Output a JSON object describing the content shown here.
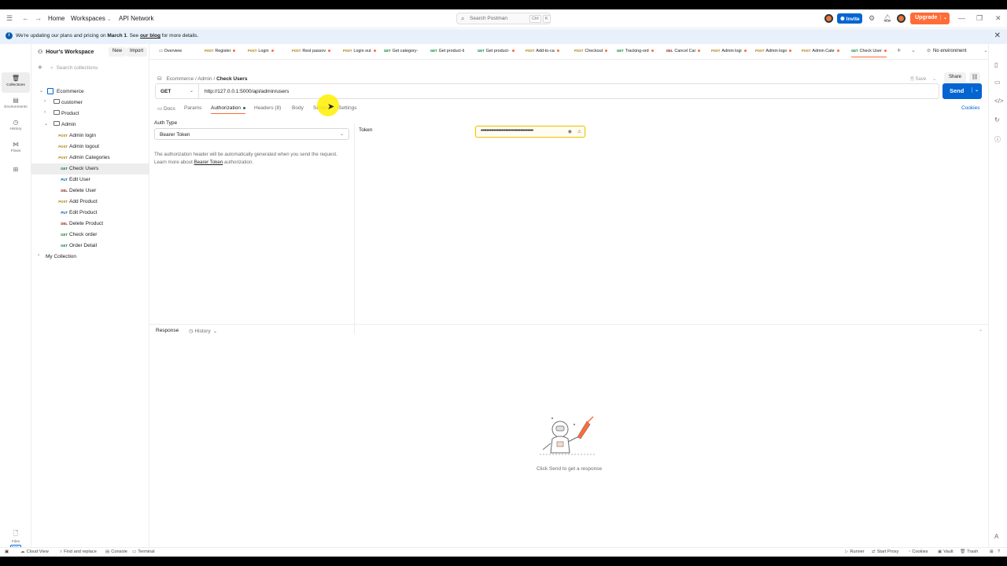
{
  "header": {
    "nav": {
      "home": "Home",
      "workspaces": "Workspaces",
      "api_network": "API Network"
    },
    "search": {
      "placeholder": "Search Postman",
      "kbd_ctrl": "Ctrl",
      "kbd_k": "K"
    },
    "invite_label": "Invite",
    "upgrade_label": "Upgrade",
    "colors": {
      "brand": "#ff6c37",
      "primary": "#0265d2"
    }
  },
  "banner": {
    "text_before": "We're updating our plans and pricing on ",
    "date": "March 1",
    "text_mid": ". See ",
    "link": "our blog",
    "text_after": " for more details."
  },
  "rail": [
    {
      "label": "Collections",
      "icon": "collections-icon"
    },
    {
      "label": "Environments",
      "icon": "environments-icon"
    },
    {
      "label": "History",
      "icon": "history-icon"
    },
    {
      "label": "Flows",
      "icon": "flows-icon"
    },
    {
      "label": "",
      "icon": "apps-icon"
    }
  ],
  "files": {
    "label": "Files",
    "badge": "BETA"
  },
  "sidebar": {
    "workspace": "Hour's Workspace",
    "new_label": "New",
    "import_label": "Import",
    "search_placeholder": "Search collections",
    "tree": [
      {
        "type": "collection",
        "label": "Ecommerce",
        "level": 0,
        "open": true
      },
      {
        "type": "folder",
        "label": "customer",
        "level": 1,
        "open": false
      },
      {
        "type": "folder",
        "label": "Product",
        "level": 1,
        "open": false
      },
      {
        "type": "folder",
        "label": "Admin",
        "level": 1,
        "open": true
      },
      {
        "type": "request",
        "method": "POST",
        "label": "Admin login",
        "level": 2
      },
      {
        "type": "request",
        "method": "POST",
        "label": "Admin logout",
        "level": 2
      },
      {
        "type": "request",
        "method": "POST",
        "label": "Admin Categories",
        "level": 2
      },
      {
        "type": "request",
        "method": "GET",
        "label": "Check Users",
        "level": 2,
        "selected": true
      },
      {
        "type": "request",
        "method": "PUT",
        "label": "Edit User",
        "level": 2
      },
      {
        "type": "request",
        "method": "DEL",
        "label": "Delete User",
        "level": 2
      },
      {
        "type": "request",
        "method": "POST",
        "label": "Add Product",
        "level": 2
      },
      {
        "type": "request",
        "method": "PUT",
        "label": "Edit Product",
        "level": 2
      },
      {
        "type": "request",
        "method": "DEL",
        "label": "Delete Product",
        "level": 2
      },
      {
        "type": "request",
        "method": "GET",
        "label": "Check order",
        "level": 2
      },
      {
        "type": "request",
        "method": "GET",
        "label": "Order Detail",
        "level": 2
      },
      {
        "type": "collection-closed",
        "label": "My Collection",
        "level": 0,
        "open": false
      }
    ]
  },
  "tabs": [
    {
      "method": "",
      "label": "Overview",
      "dot": false
    },
    {
      "method": "POST",
      "label": "Register",
      "dot": true
    },
    {
      "method": "POST",
      "label": "Login",
      "dot": true
    },
    {
      "method": "POST",
      "label": "Rest passov",
      "dot": true
    },
    {
      "method": "POST",
      "label": "Login out",
      "dot": true
    },
    {
      "method": "GET",
      "label": "Get category-",
      "dot": false
    },
    {
      "method": "GET",
      "label": "Get product-li",
      "dot": false
    },
    {
      "method": "GET",
      "label": "Get product-",
      "dot": true
    },
    {
      "method": "POST",
      "label": "Add-to-ca",
      "dot": true
    },
    {
      "method": "POST",
      "label": "Checkout",
      "dot": true
    },
    {
      "method": "GET",
      "label": "Tracking-ord",
      "dot": true
    },
    {
      "method": "DEL",
      "label": "Cancel Car",
      "dot": true
    },
    {
      "method": "POST",
      "label": "Admin logi",
      "dot": true
    },
    {
      "method": "POST",
      "label": "Admin logo",
      "dot": true
    },
    {
      "method": "POST",
      "label": "Admin Cate",
      "dot": true
    },
    {
      "method": "GET",
      "label": "Check User",
      "dot": true,
      "active": true
    }
  ],
  "environment": "No environment",
  "request": {
    "breadcrumb": [
      "Ecommerce",
      "Admin"
    ],
    "title": "Check Users",
    "save_label": "Save",
    "share_label": "Share",
    "method": "GET",
    "url": "http://127.0.0.1:5000/api/admin/users",
    "send_label": "Send",
    "tabs": [
      "Docs",
      "Params",
      "Authorization",
      "Headers (8)",
      "Body",
      "Scripts",
      "Settings"
    ],
    "active_tab": "Authorization",
    "cookies_label": "Cookies"
  },
  "auth": {
    "type_label": "Auth Type",
    "type_value": "Bearer Token",
    "desc_1": "The authorization header will be automatically generated when you send the request.",
    "desc_2a": "Learn more about ",
    "desc_link": "Bearer Token",
    "desc_2b": " authorization.",
    "token_label": "Token",
    "token_value": "••••••••••••••••••••••••••••••••••••"
  },
  "response": {
    "label": "Response",
    "history_label": "History",
    "empty_message": "Click Send to get a response"
  },
  "footer": {
    "left": [
      {
        "label": "Cloud View",
        "icon": "cloud-icon"
      },
      {
        "label": "Find and replace",
        "icon": "find-icon"
      },
      {
        "label": "Console",
        "icon": "console-icon"
      },
      {
        "label": "Terminal",
        "icon": "terminal-icon"
      }
    ],
    "right": [
      {
        "label": "Runner",
        "icon": "runner-icon"
      },
      {
        "label": "Start Proxy",
        "icon": "proxy-icon"
      },
      {
        "label": "Cookies",
        "icon": "cookie-icon"
      },
      {
        "label": "Vault",
        "icon": "vault-icon"
      },
      {
        "label": "Trash",
        "icon": "trash-icon"
      }
    ]
  }
}
